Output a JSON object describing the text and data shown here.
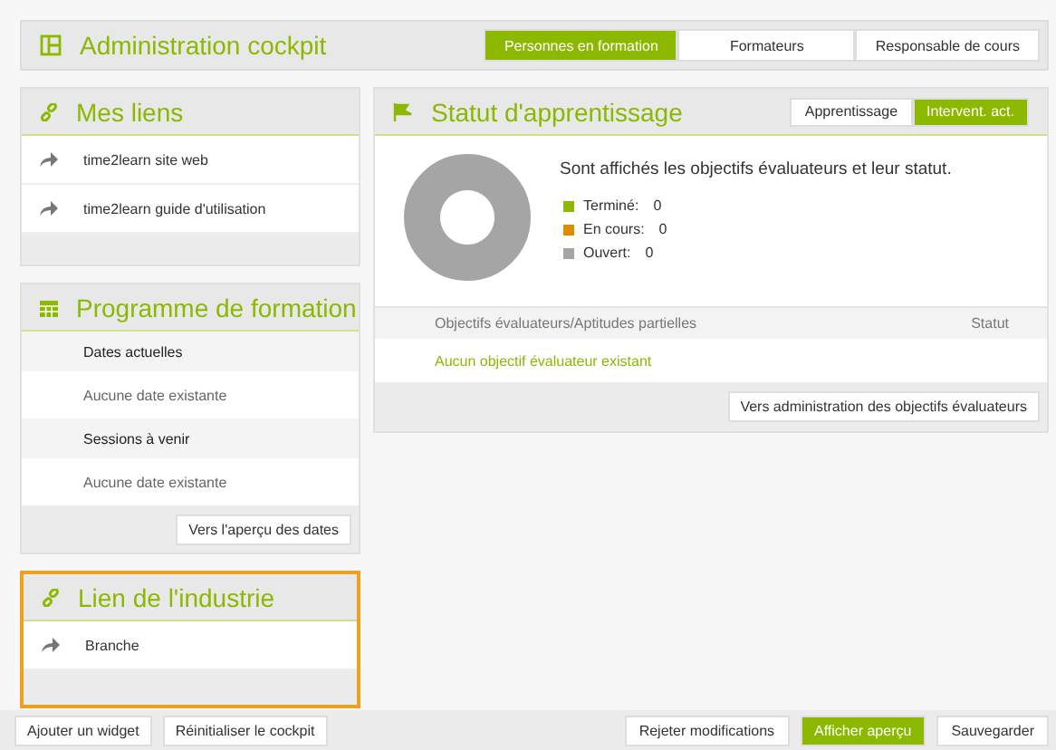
{
  "header": {
    "title": "Administration cockpit",
    "tabs": [
      {
        "label": "Personnes en formation",
        "selected": true
      },
      {
        "label": "Formateurs",
        "selected": false
      },
      {
        "label": "Responsable de cours",
        "selected": false
      }
    ]
  },
  "links_widget": {
    "title": "Mes liens",
    "highlighted": false,
    "items": [
      "time2learn site web",
      "time2learn guide d'utilisation"
    ]
  },
  "program_widget": {
    "title": "Programme de formation",
    "highlighted": false,
    "rows": [
      {
        "kind": "heading",
        "text": "Dates actuelles"
      },
      {
        "kind": "empty",
        "text": "Aucune date existante"
      },
      {
        "kind": "heading",
        "text": "Sessions à venir"
      },
      {
        "kind": "empty",
        "text": "Aucune date existante"
      }
    ],
    "button": "Vers l'aperçu des dates"
  },
  "industry_widget": {
    "title": "Lien de l'industrie",
    "highlighted": true,
    "items": [
      "Branche"
    ]
  },
  "status_widget": {
    "title": "Statut d'apprentissage",
    "tabs": [
      {
        "label": "Apprentissage",
        "selected": false
      },
      {
        "label": "Intervent. act.",
        "selected": true
      }
    ],
    "description": "Sont affichés les objectifs évaluateurs et leur statut.",
    "legend": [
      {
        "label": "Terminé:",
        "value": "0",
        "color": "#8cb800"
      },
      {
        "label": "En cours:",
        "value": "0",
        "color": "#e08a00"
      },
      {
        "label": "Ouvert:",
        "value": "0",
        "color": "#a5a5a5"
      }
    ],
    "columns": [
      "Objectifs évaluateurs/Aptitudes partielles",
      "Statut"
    ],
    "empty_row": "Aucun objectif évaluateur existant",
    "button": "Vers administration des objectifs évaluateurs"
  },
  "footer": {
    "left_buttons": [
      "Ajouter un widget",
      "Réinitialiser le cockpit"
    ],
    "right_buttons": [
      {
        "label": "Rejeter modifications",
        "primary": false
      },
      {
        "label": "Afficher aperçu",
        "primary": true
      },
      {
        "label": "Sauvegarder",
        "primary": false
      }
    ]
  }
}
